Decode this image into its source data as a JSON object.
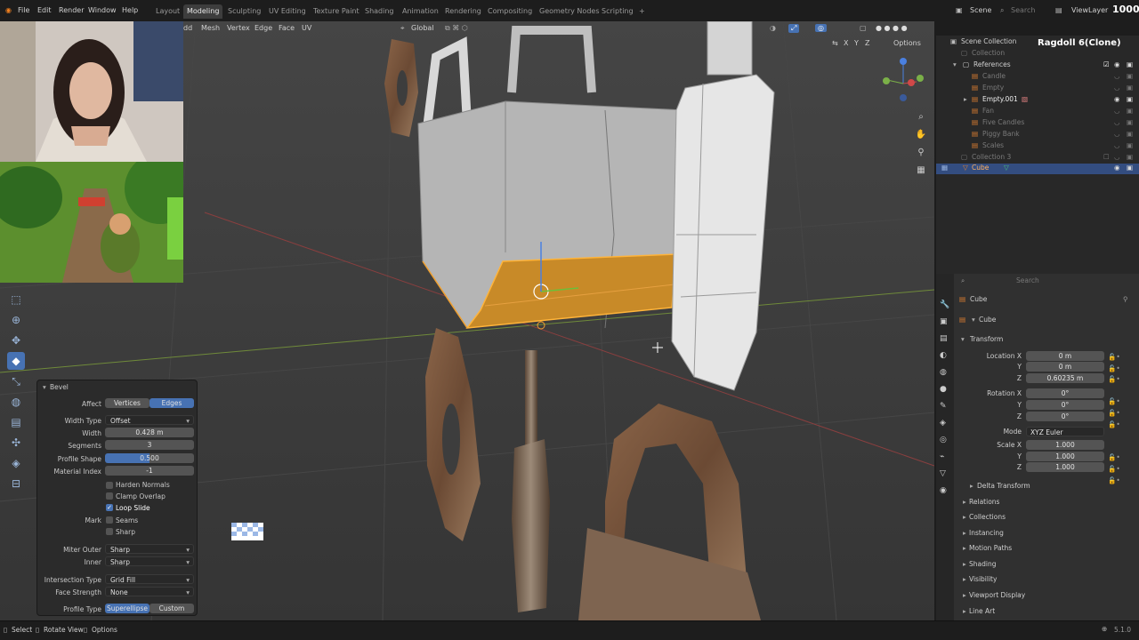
{
  "menu": [
    "File",
    "Edit",
    "Render",
    "Window",
    "Help"
  ],
  "workspaces": [
    "Layout",
    "Modeling",
    "Sculpting",
    "UV Editing",
    "Texture Paint",
    "Shading",
    "Animation",
    "Rendering",
    "Compositing",
    "Geometry Nodes",
    "Scripting"
  ],
  "active_workspace": "Modeling",
  "add_tab": "+",
  "scene_name": "Scene",
  "view_layer": "ViewLayer",
  "counter": "1000",
  "search_placeholder": "Search",
  "viewport": {
    "menus": [
      "dd",
      "Mesh",
      "Vertex",
      "Edge",
      "Face",
      "UV"
    ],
    "orientation": "Global",
    "options": "Options",
    "axes": [
      "X",
      "Y",
      "Z"
    ]
  },
  "watermark": "Ragdoll 6(Clone)",
  "bevel": {
    "title": "Bevel",
    "affect_label": "Affect",
    "affect_options": [
      "Vertices",
      "Edges"
    ],
    "affect_selected": "Edges",
    "width_type_label": "Width Type",
    "width_type": "Offset",
    "width_label": "Width",
    "width": "0.428 m",
    "segments_label": "Segments",
    "segments": "3",
    "profile_shape_label": "Profile Shape",
    "profile_shape": "0.500",
    "material_index_label": "Material Index",
    "material_index": "-1",
    "harden_normals": "Harden Normals",
    "clamp_overlap": "Clamp Overlap",
    "loop_slide": "Loop Slide",
    "mark_label": "Mark",
    "seams": "Seams",
    "sharp": "Sharp",
    "miter_outer_label": "Miter Outer",
    "miter_outer": "Sharp",
    "inner_label": "Inner",
    "inner": "Sharp",
    "intersection_type_label": "Intersection Type",
    "intersection_type": "Grid Fill",
    "face_strength_label": "Face Strength",
    "face_strength": "None",
    "profile_type_label": "Profile Type",
    "profile_type_options": [
      "Superellipse",
      "Custom"
    ],
    "profile_type_selected": "Superellipse"
  },
  "outliner": {
    "items": [
      {
        "label": "Scene Collection",
        "dim": false
      },
      {
        "label": "Collection",
        "dim": true
      },
      {
        "label": "References",
        "dim": false
      },
      {
        "label": "Candle",
        "dim": true
      },
      {
        "label": "Empty",
        "dim": true
      },
      {
        "label": "Empty.001",
        "dim": false
      },
      {
        "label": "Fan",
        "dim": true
      },
      {
        "label": "Five Candles",
        "dim": true
      },
      {
        "label": "Piggy Bank",
        "dim": true
      },
      {
        "label": "Scales",
        "dim": true
      },
      {
        "label": "Collection 3",
        "dim": true
      },
      {
        "label": "Cube",
        "dim": false
      }
    ]
  },
  "properties": {
    "object_name": "Cube",
    "data_name": "Cube",
    "transform": "Transform",
    "location_label": "Location X",
    "location": [
      "0 m",
      "0 m",
      "0.60235 m"
    ],
    "rotation_label": "Rotation X",
    "rotation": [
      "0°",
      "0°",
      "0°"
    ],
    "mode_label": "Mode",
    "mode": "XYZ Euler",
    "scale_label": "Scale X",
    "scale": [
      "1.000",
      "1.000",
      "1.000"
    ],
    "y_label": "Y",
    "z_label": "Z",
    "delta_transform": "Delta Transform",
    "panels": [
      "Relations",
      "Collections",
      "Instancing",
      "Motion Paths",
      "Shading",
      "Visibility",
      "Viewport Display",
      "Line Art"
    ]
  },
  "status": {
    "select": "Select",
    "rotate": "Rotate View",
    "options": "Options",
    "version": "5.1.0"
  },
  "colors": {
    "accent": "#4772b3",
    "selection": "#f0a030",
    "panel": "#2b2b2b",
    "viewport": "#3d3d3d"
  }
}
